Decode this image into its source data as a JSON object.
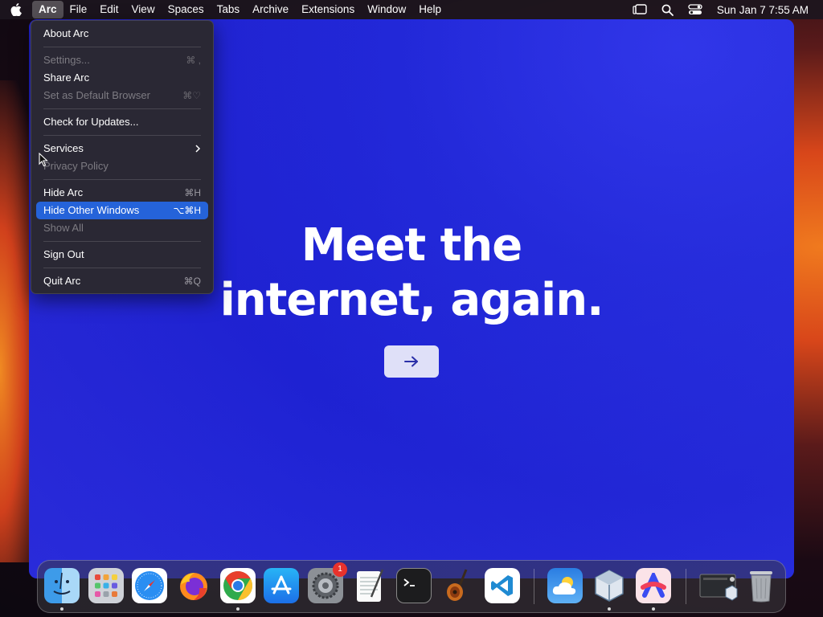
{
  "menubar": {
    "items": [
      "Arc",
      "File",
      "Edit",
      "View",
      "Spaces",
      "Tabs",
      "Archive",
      "Extensions",
      "Window",
      "Help"
    ],
    "active_index": 0,
    "clock": "Sun Jan 7  7:55 AM"
  },
  "dropdown": {
    "about": "About Arc",
    "settings": {
      "label": "Settings...",
      "shortcut": "⌘ ,"
    },
    "share": "Share Arc",
    "default_browser": {
      "label": "Set as Default Browser",
      "shortcut": "⌘♡"
    },
    "check_updates": "Check for Updates...",
    "services": "Services",
    "privacy": "Privacy Policy",
    "hide": {
      "label": "Hide Arc",
      "shortcut": "⌘H"
    },
    "hide_others": {
      "label": "Hide Other Windows",
      "shortcut": "⌥⌘H"
    },
    "show_all": "Show All",
    "sign_out": "Sign Out",
    "quit": {
      "label": "Quit Arc",
      "shortcut": "⌘Q"
    }
  },
  "content": {
    "headline_line1": "Meet the",
    "headline_line2": "internet, again.",
    "next_icon": "arrow-right-icon"
  },
  "dock": {
    "apps": [
      "finder",
      "launchpad",
      "safari",
      "firefox",
      "chrome",
      "app-store",
      "system-settings",
      "textedit",
      "terminal",
      "garageband",
      "vscode",
      "weather",
      "virtualbox",
      "arc",
      "screenshot-folder",
      "trash"
    ],
    "settings_badge": "1"
  },
  "colors": {
    "highlight": "#2563d9",
    "window_bg": "#2228d8"
  }
}
